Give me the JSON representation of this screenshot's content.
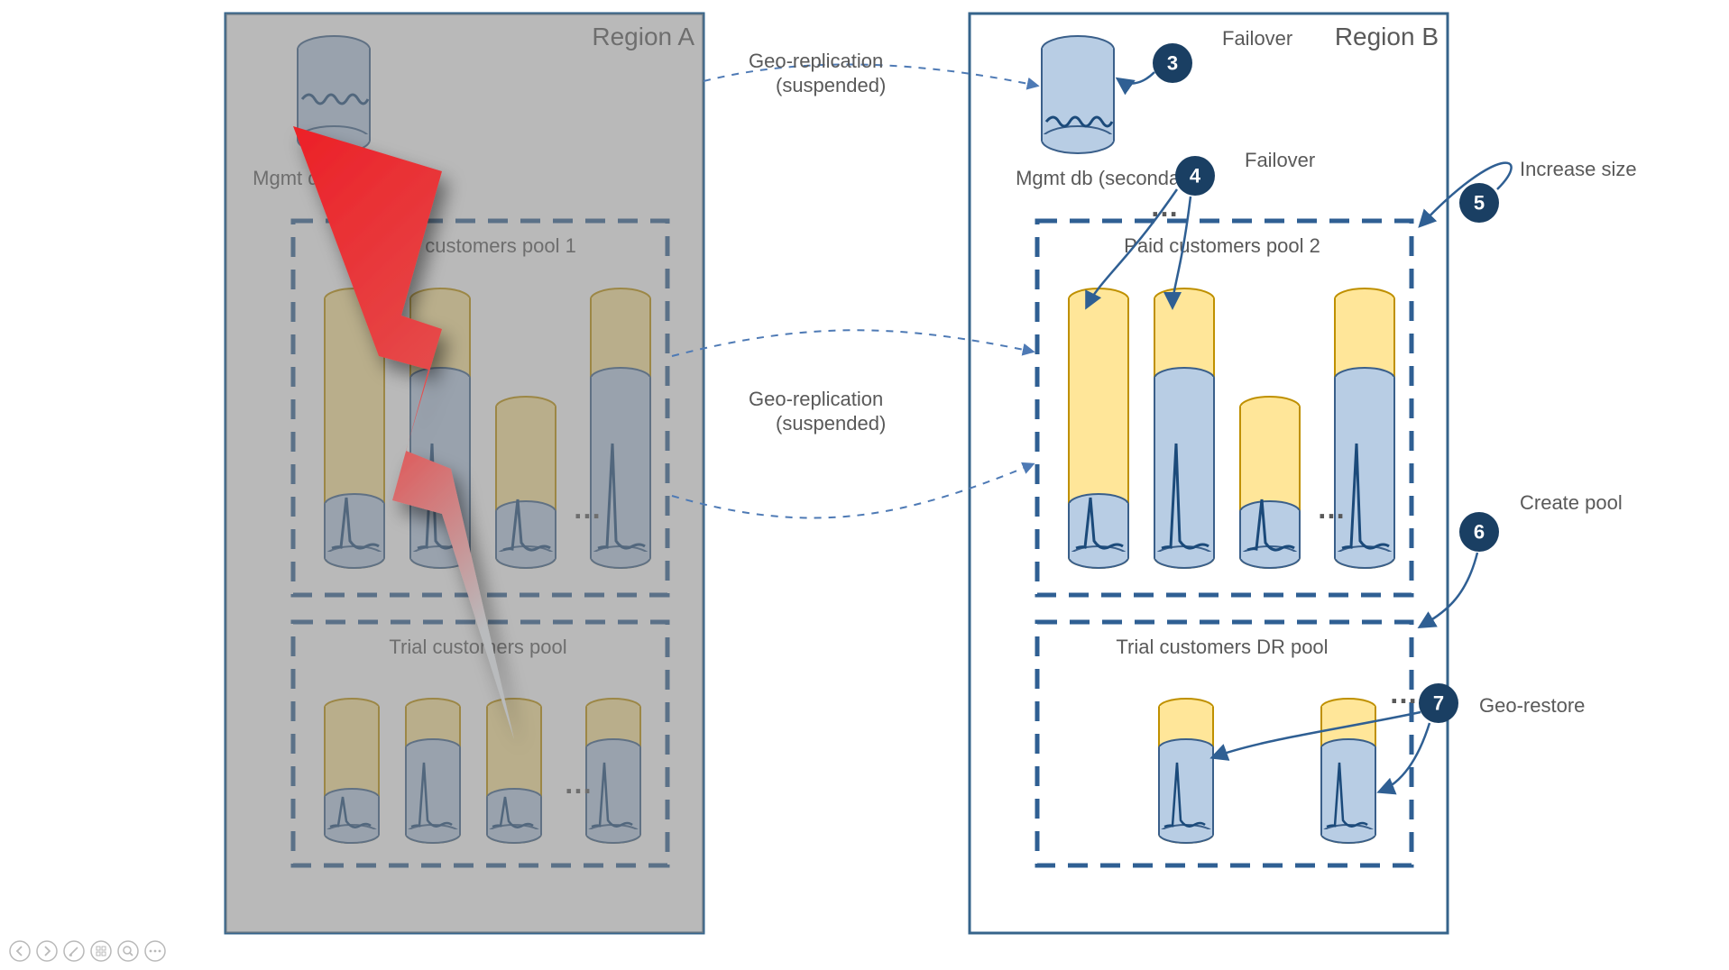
{
  "regionA": {
    "title": "Region A",
    "mgmt": "Mgmt db (primary)",
    "pool1": "Paid customers pool 1",
    "pool2": "Trial customers pool"
  },
  "regionB": {
    "title": "Region B",
    "mgmt": "Mgmt db (secondary)",
    "pool1": "Paid customers pool 2",
    "pool2": "Trial customers DR pool"
  },
  "links": {
    "geo1a": "Geo-replication",
    "geo1b": "(suspended)",
    "geo2a": "Geo-replication",
    "geo2b": "(suspended)"
  },
  "steps": {
    "s3": {
      "n": "3",
      "label": "Failover"
    },
    "s4": {
      "n": "4",
      "label": "Failover"
    },
    "s5": {
      "n": "5",
      "label": "Increase size"
    },
    "s6": {
      "n": "6",
      "label": "Create pool"
    },
    "s7": {
      "n": "7",
      "label": "Geo-restore"
    }
  },
  "ellipsis": "…"
}
